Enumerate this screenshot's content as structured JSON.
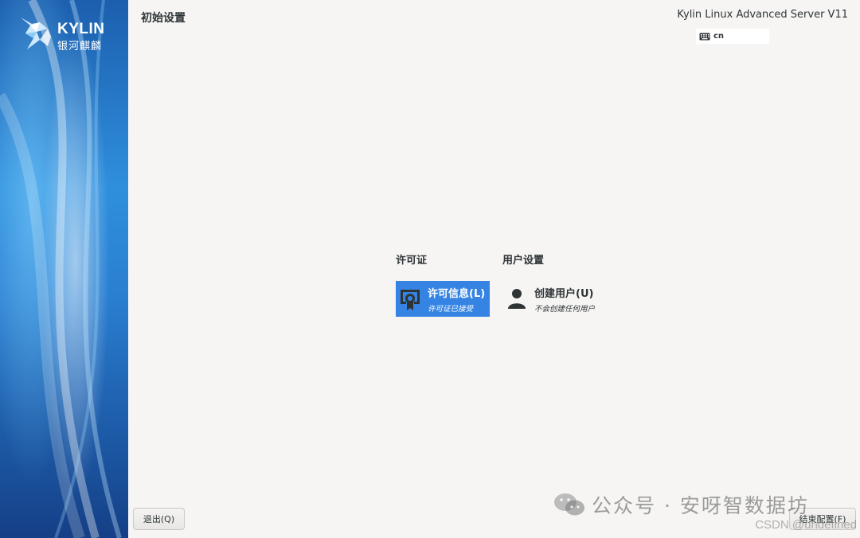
{
  "sidebar": {
    "logo_text": "KYLIN",
    "logo_sub": "银河麒麟"
  },
  "header": {
    "title": "初始设置",
    "product": "Kylin Linux Advanced Server V11",
    "keyboard_layout": "cn"
  },
  "categories": [
    {
      "label": "许可证",
      "spoke": {
        "title": "许可信息(L)",
        "status": "许可证已接受",
        "icon": "certificate-icon",
        "selected": true
      }
    },
    {
      "label": "用户设置",
      "spoke": {
        "title": "创建用户(U)",
        "status": "不会创建任何用户",
        "icon": "user-icon",
        "selected": false
      }
    }
  ],
  "buttons": {
    "quit": "退出(Q)",
    "finish": "结束配置(F)"
  },
  "watermarks": {
    "wechat": "公众号 · 安呀智数据坊",
    "csdn": "CSDN @undefined"
  },
  "colors": {
    "accent": "#3584e4",
    "background": "#f6f5f4",
    "sidebar_blue": "#2f8fdd"
  }
}
